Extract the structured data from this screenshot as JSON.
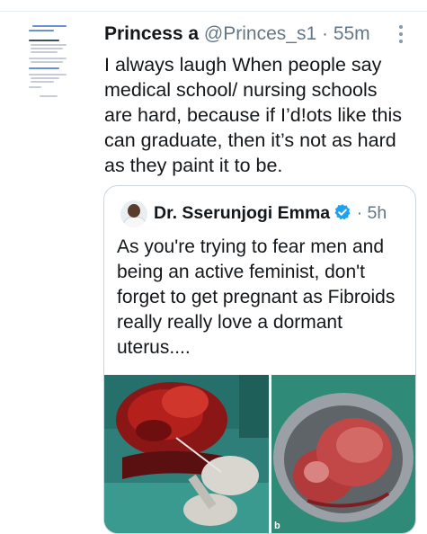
{
  "tweet": {
    "author_name": "Princess a",
    "author_handle": "@Princes_s1",
    "separator": "·",
    "time": "55m",
    "text": "I always laugh When people say medical school/ nursing schools are hard, because if I’d!ots  like this can graduate, then it’s not as hard as they paint it to be."
  },
  "quoted_tweet": {
    "author_name": "Dr. Sserunjogi Emma",
    "separator": "·",
    "time": "5h",
    "text": "As you're trying to fear men and being an active feminist, don't forget to get pregnant as Fibroids really really love a dormant uterus....",
    "image_label": "b"
  },
  "colors": {
    "verified": "#1da1f2",
    "muted": "#657786",
    "border": "#ccd6dd"
  },
  "icons": {
    "more": "more-vertical-icon",
    "verified": "verified-badge-icon"
  }
}
